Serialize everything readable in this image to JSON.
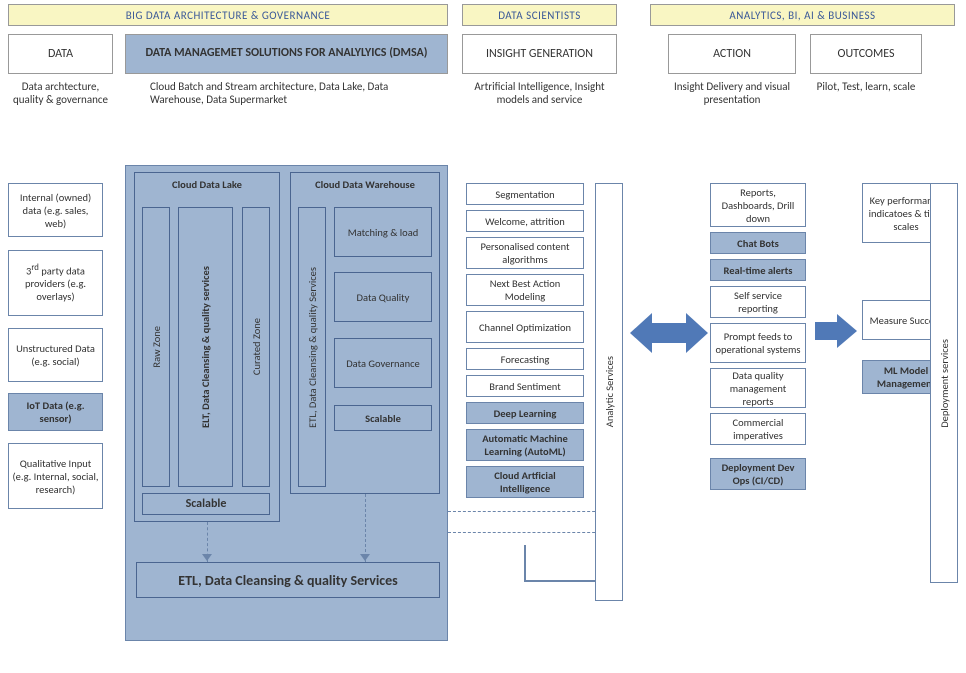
{
  "bands": {
    "big_data": "BIG DATA ARCHITECTURE & GOVERNANCE",
    "data_scientists": "DATA SCIENTISTS",
    "analytics": "ANALYTICS, BI, AI & BUSINESS"
  },
  "headers": {
    "data": "DATA",
    "dmsa": "DATA MANAGEMET SOLUTIONS FOR ANALYLYICS (DMSA)",
    "insight": "INSIGHT GENERATION",
    "action": "ACTION",
    "outcomes": "OUTCOMES"
  },
  "subtitles": {
    "data": "Data archtecture, quality & governance",
    "dmsa": "Cloud Batch and Stream architecture, Data Lake, Data Warehouse, Data Supermarket",
    "insight": "Artrificial Intelligence, Insight models and service",
    "action": "Insight Delivery and visual presentation",
    "outcomes": "Pilot, Test, learn, scale"
  },
  "data_sources": {
    "internal": "Internal (owned) data (e.g. sales, web)",
    "third_party": "3rd party data providers (e.g. overlays)",
    "unstructured": "Unstructured Data (e.g. social)",
    "iot": "IoT Data (e.g. sensor)",
    "qualitative": "Qualitative Input (e.g. Internal, social, research)"
  },
  "dmsa": {
    "datalake": {
      "title": "Cloud Data Lake",
      "raw": "Raw Zone",
      "elt": "ELT, Data Cleansing & quality services",
      "curated": "Curated Zone",
      "scalable": "Scalable"
    },
    "warehouse": {
      "title": "Cloud Data Warehouse",
      "etl": "ETL, Data Cleansing & quality Services",
      "matching": "Matching & load",
      "quality": "Data Quality",
      "governance": "Data Governance",
      "scalable": "Scalable"
    },
    "etl_bar": "ETL, Data Cleansing & quality Services"
  },
  "insight": {
    "items": [
      "Segmentation",
      "Welcome, attrition",
      "Personalised content algorithms",
      "Next Best Action Modeling",
      "Channel Optimization",
      "Forecasting",
      "Brand Sentiment",
      "Deep Learning",
      "Automatic Machine Learning (AutoML)",
      "Cloud Artficial Intelligence"
    ],
    "analytic_services": "Analytic Services"
  },
  "action": {
    "items": [
      "Reports, Dashboards, Drill down",
      "Chat Bots",
      "Real-time alerts",
      "Self service reporting",
      "Prompt feeds to operational systems",
      "Data quality management reports",
      "Commercial imperatives",
      "Deployment Dev Ops (CI/CD)"
    ]
  },
  "outcomes": {
    "items": [
      "Key performance indicatoes & time scales",
      "Measure Success",
      "ML Model Management"
    ],
    "deployment": "Deployment services"
  }
}
